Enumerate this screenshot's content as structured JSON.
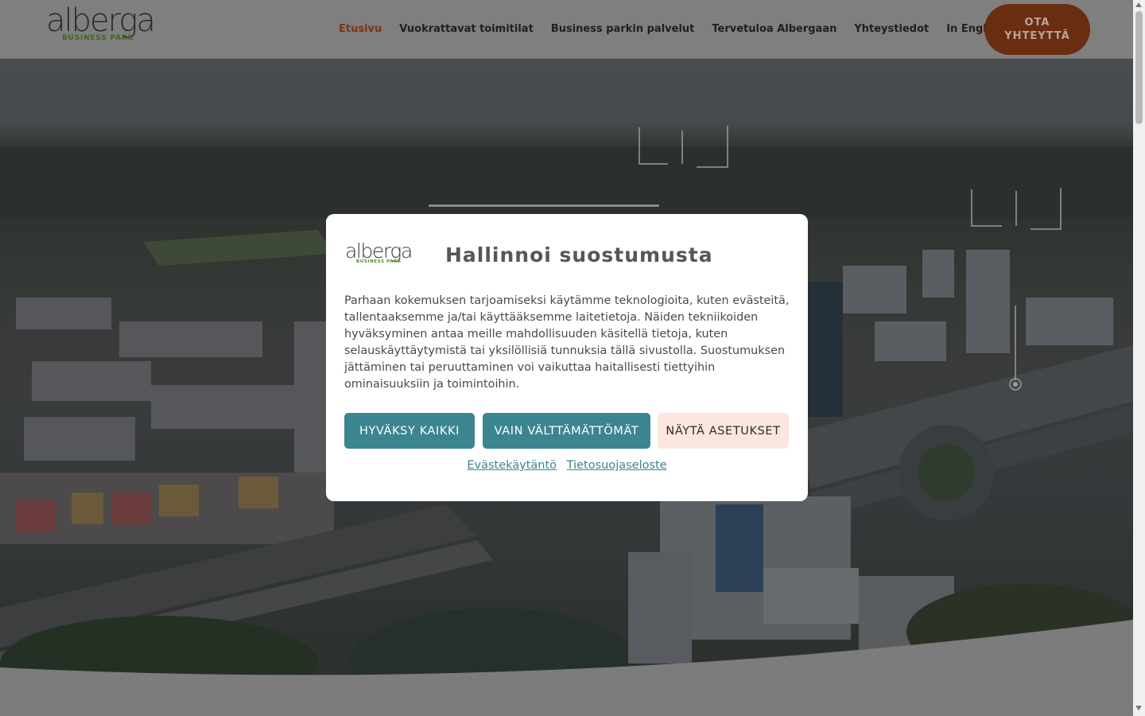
{
  "logo": {
    "word": "alberga",
    "sub": "BUSINESS PARK"
  },
  "nav": {
    "items": [
      {
        "label": "Etusivu",
        "active": true
      },
      {
        "label": "Vuokrattavat toimitilat",
        "active": false
      },
      {
        "label": "Business parkin palvelut",
        "active": false
      },
      {
        "label": "Tervetuloa Albergaan",
        "active": false
      },
      {
        "label": "Yhteystiedot",
        "active": false
      },
      {
        "label": "In English",
        "active": false
      }
    ],
    "cta_label": "OTA YHTEYTTÄ"
  },
  "consent": {
    "logo_word": "alberga",
    "logo_sub": "BUSINESS PARK",
    "title": "Hallinnoi suostumusta",
    "text": "Parhaan kokemuksen tarjoamiseksi käytämme teknologioita, kuten evästeitä, tallentaaksemme ja/tai käyttääksemme laitetietoja. Näiden tekniikoiden hyväksyminen antaa meille mahdollisuuden käsitellä tietoja, kuten selauskäyttäytymistä tai yksilöllisiä tunnuksia tällä sivustolla. Suostumuksen jättäminen tai peruuttaminen voi vaikuttaa haitallisesti tiettyihin ominaisuuksiin ja toimintoihin.",
    "accept_all": "HYVÄKSY KAIKKI",
    "only_necessary": "VAIN VÄLTTÄMÄTTÖMÄT",
    "show_settings": "NÄYTÄ ASETUKSET",
    "cookie_policy_link": "Evästekäytäntö",
    "privacy_link": "Tietosuojaseloste"
  },
  "colors": {
    "accent_teal": "#3b8590",
    "brand_brown": "#6a2d12",
    "active_nav": "#7a3418",
    "settings_bg": "#fbe7e0"
  }
}
